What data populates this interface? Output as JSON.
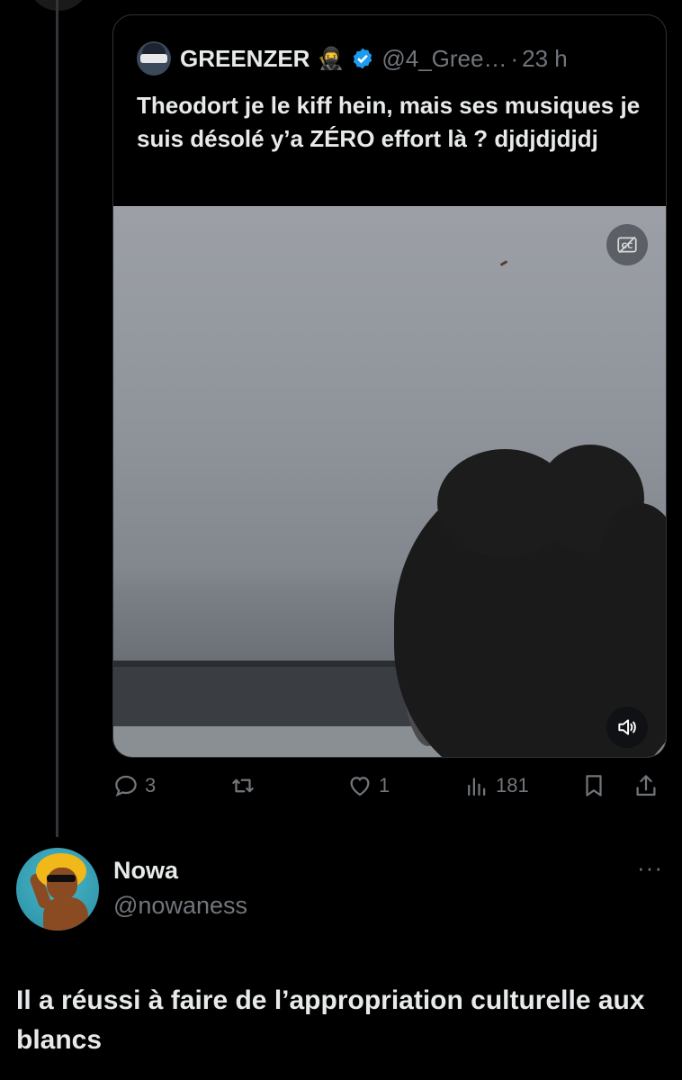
{
  "quoted_tweet": {
    "author_name": "GREENZER",
    "author_emoji": "🥷",
    "handle": "@4_Gree…",
    "separator": "·",
    "time": "23 h",
    "text": "Theodort je le kiff hein, mais ses musiques je suis désolé y’a ZÉRO effort là ? djdjdjdjdj",
    "media": {
      "type": "video",
      "captions_button": "cc-icon",
      "sound_button": "speaker-icon"
    }
  },
  "actions": {
    "replies": "3",
    "retweets": "",
    "likes": "1",
    "views": "181"
  },
  "reply": {
    "author_name": "Nowa",
    "handle": "@nowaness",
    "more": "···",
    "text": "Il a réussi à faire de l’appropriation culturelle aux blancs"
  },
  "colors": {
    "background": "#000000",
    "text_primary": "#e7e9ea",
    "text_secondary": "#71767b",
    "border": "#2f3336",
    "verified_blue": "#1d9bf0"
  }
}
